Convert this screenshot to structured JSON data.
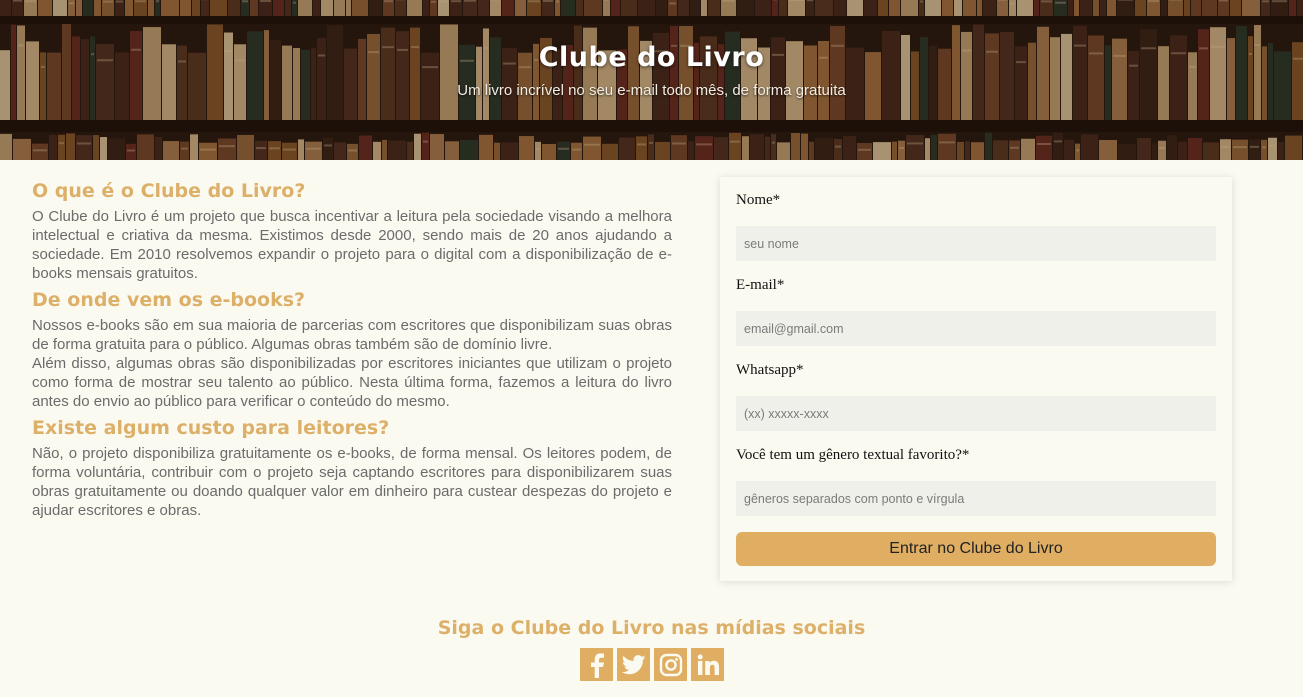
{
  "header": {
    "title": "Clube do Livro",
    "subtitle": "Um livro incrível no seu e-mail todo mês, de forma gratuita"
  },
  "sections": [
    {
      "title": "O que é o Clube do Livro?",
      "paragraphs": [
        "O Clube do Livro é um projeto que busca incentivar a leitura pela sociedade visando a melhora intelectual e criativa da mesma. Existimos desde 2000, sendo mais de 20 anos ajudando a sociedade. Em 2010 resolvemos expandir o projeto para o digital com a disponibilização de e-books mensais gratuitos."
      ]
    },
    {
      "title": "De onde vem os e-books?",
      "paragraphs": [
        "Nossos e-books são em sua maioria de parcerias com escritores que disponibilizam suas obras de forma gratuita para o público. Algumas obras também são de domínio livre.",
        "Além disso, algumas obras são disponibilizadas por escritores iniciantes que utilizam o projeto como forma de mostrar seu talento ao público. Nesta última forma, fazemos a leitura do livro antes do envio ao público para verificar o conteúdo do mesmo."
      ]
    },
    {
      "title": "Existe algum custo para leitores?",
      "paragraphs": [
        "Não, o projeto disponibiliza gratuitamente os e-books, de forma mensal. Os leitores podem, de forma voluntária, contribuir com o projeto seja captando escritores para disponibilizarem suas obras gratuitamente ou doando qualquer valor em dinheiro para custear despezas do projeto e ajudar escritores e obras."
      ]
    }
  ],
  "form": {
    "fields": [
      {
        "label": "Nome*",
        "placeholder": "seu nome",
        "value": ""
      },
      {
        "label": "E-mail*",
        "placeholder": "email@gmail.com",
        "value": ""
      },
      {
        "label": "Whatsapp*",
        "placeholder": "(xx) xxxxx-xxxx",
        "value": ""
      },
      {
        "label": "Você tem um gênero textual favorito?*",
        "placeholder": "gêneros separados com ponto e vírgula",
        "value": ""
      }
    ],
    "submit_label": "Entrar no Clube do Livro"
  },
  "footer": {
    "title": "Siga o Clube do Livro nas mídias sociais",
    "social_icons": [
      "facebook-icon",
      "twitter-icon",
      "instagram-icon",
      "linkedin-icon"
    ]
  },
  "colors": {
    "accent": "#dfae62",
    "heading": "#ddb06a",
    "background": "#fbfaf0",
    "input_bg": "#f0f0ea"
  }
}
